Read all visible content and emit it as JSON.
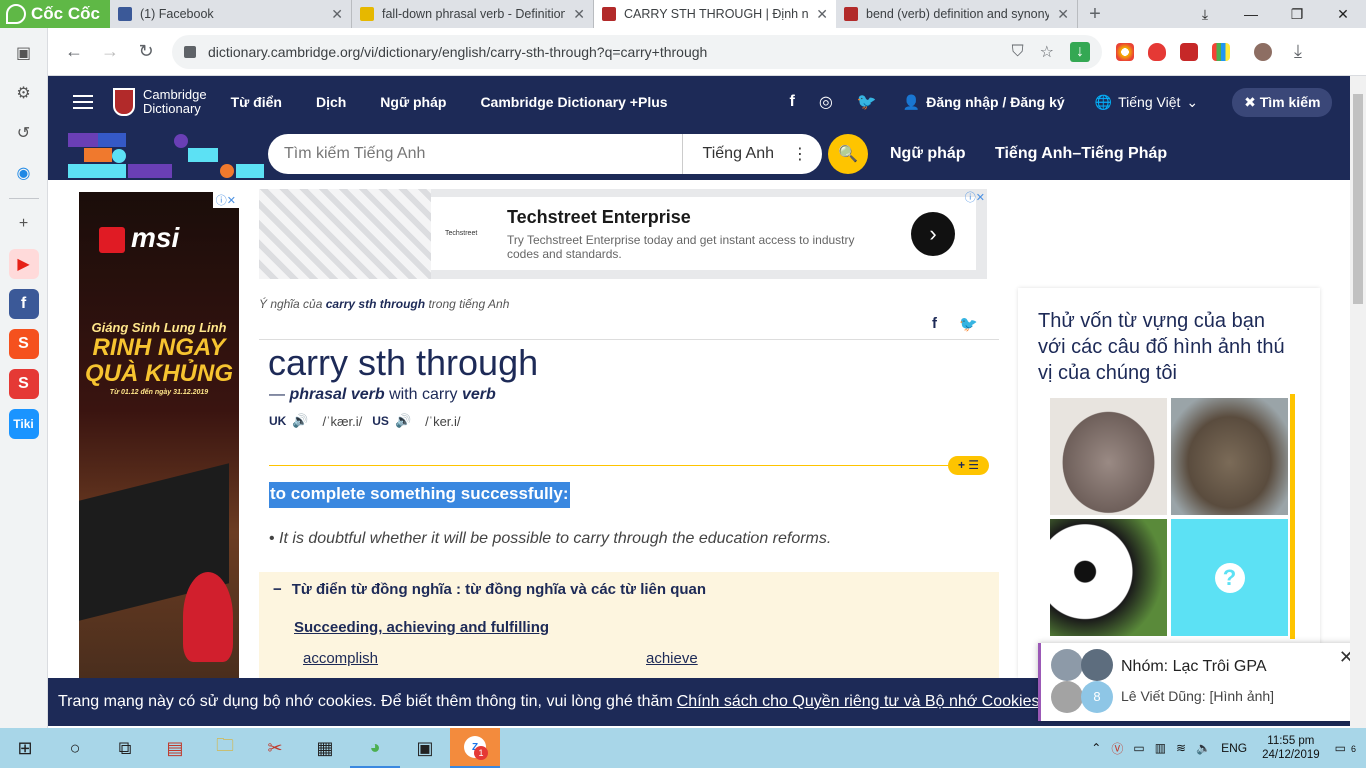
{
  "browser": {
    "brand": "Cốc Cốc",
    "tabs": [
      {
        "label": "(1) Facebook",
        "active": false,
        "color": "#3b5998"
      },
      {
        "label": "fall-down phrasal verb - Definition",
        "active": false,
        "color": "#e6b800"
      },
      {
        "label": "CARRY STH THROUGH | Định nghĩa",
        "active": true,
        "color": "#b22a2a"
      },
      {
        "label": "bend (verb) definition and synonym",
        "active": false,
        "color": "#b22a2a"
      }
    ],
    "new_tab": "+",
    "url": "dictionary.cambridge.org/vi/dictionary/english/carry-sth-through?q=carry+through"
  },
  "site": {
    "logo_line1": "Cambridge",
    "logo_line2": "Dictionary",
    "nav": [
      "Từ điển",
      "Dịch",
      "Ngữ pháp",
      "Cambridge Dictionary +Plus"
    ],
    "social": [
      "f",
      "◎",
      "🐦"
    ],
    "login": "Đăng nhập / Đăng ký",
    "language": "Tiếng Việt",
    "search_button": "Tìm kiếm",
    "search_placeholder": "Tìm kiếm Tiếng Anh",
    "dictionary_select": "Tiếng Anh",
    "sub_links": [
      "Ngữ pháp",
      "Tiếng Anh–Tiếng Pháp"
    ]
  },
  "ads": {
    "left_brand": "msi",
    "left_promo_line1": "Giáng Sinh Lung Linh",
    "left_promo_line2": "RINH NGAY QUÀ KHỦNG",
    "left_promo_dates": "Từ 01.12 đến ngày 31.12.2019",
    "top_brand_small": "Techstreet",
    "top_title": "Techstreet Enterprise",
    "top_desc": "Try Techstreet Enterprise today and get instant access to industry codes and standards."
  },
  "entry": {
    "meaning_prefix": "Ý nghĩa của",
    "meaning_word": "carry sth through",
    "meaning_suffix": "trong tiếng Anh",
    "headword": "carry sth through",
    "pos_dash": "—",
    "pos": "phrasal verb",
    "with_text": "with carry",
    "verb": "verb",
    "uk_label": "UK",
    "uk_ipa": "/ˈkær.i/",
    "us_label": "US",
    "us_ipa": "/ˈker.i/",
    "sense_button": "+ ☰",
    "definition": "to complete something successfully:",
    "example": "It is doubtful whether it will be possible to carry through the education reforms.",
    "thesaurus_head": "Từ điển từ đồng nghĩa : từ đồng nghĩa và các từ liên quan",
    "thesaurus_category": "Succeeding, achieving and fulfilling",
    "thesaurus_words": [
      "accomplish",
      "achieve"
    ]
  },
  "quiz": {
    "title": "Thử vốn từ vựng của bạn với các câu đố hình ảnh thú vị của chúng tôi"
  },
  "cookie": {
    "text": "Trang mạng này có sử dụng bộ nhớ cookies. Để biết thêm thông tin, vui lòng ghé thăm",
    "link": "Chính sách cho Quyền riêng tư và Bộ nhớ Cookies"
  },
  "chat": {
    "name": "Nhóm: Lạc Trôi GPA",
    "message": "Lê Viết Dũng: [Hình ảnh]",
    "badge": "8"
  },
  "taskbar": {
    "lang": "ENG",
    "time": "11:55 pm",
    "date": "24/12/2019",
    "notif": "6",
    "zalo_badge": "1"
  }
}
